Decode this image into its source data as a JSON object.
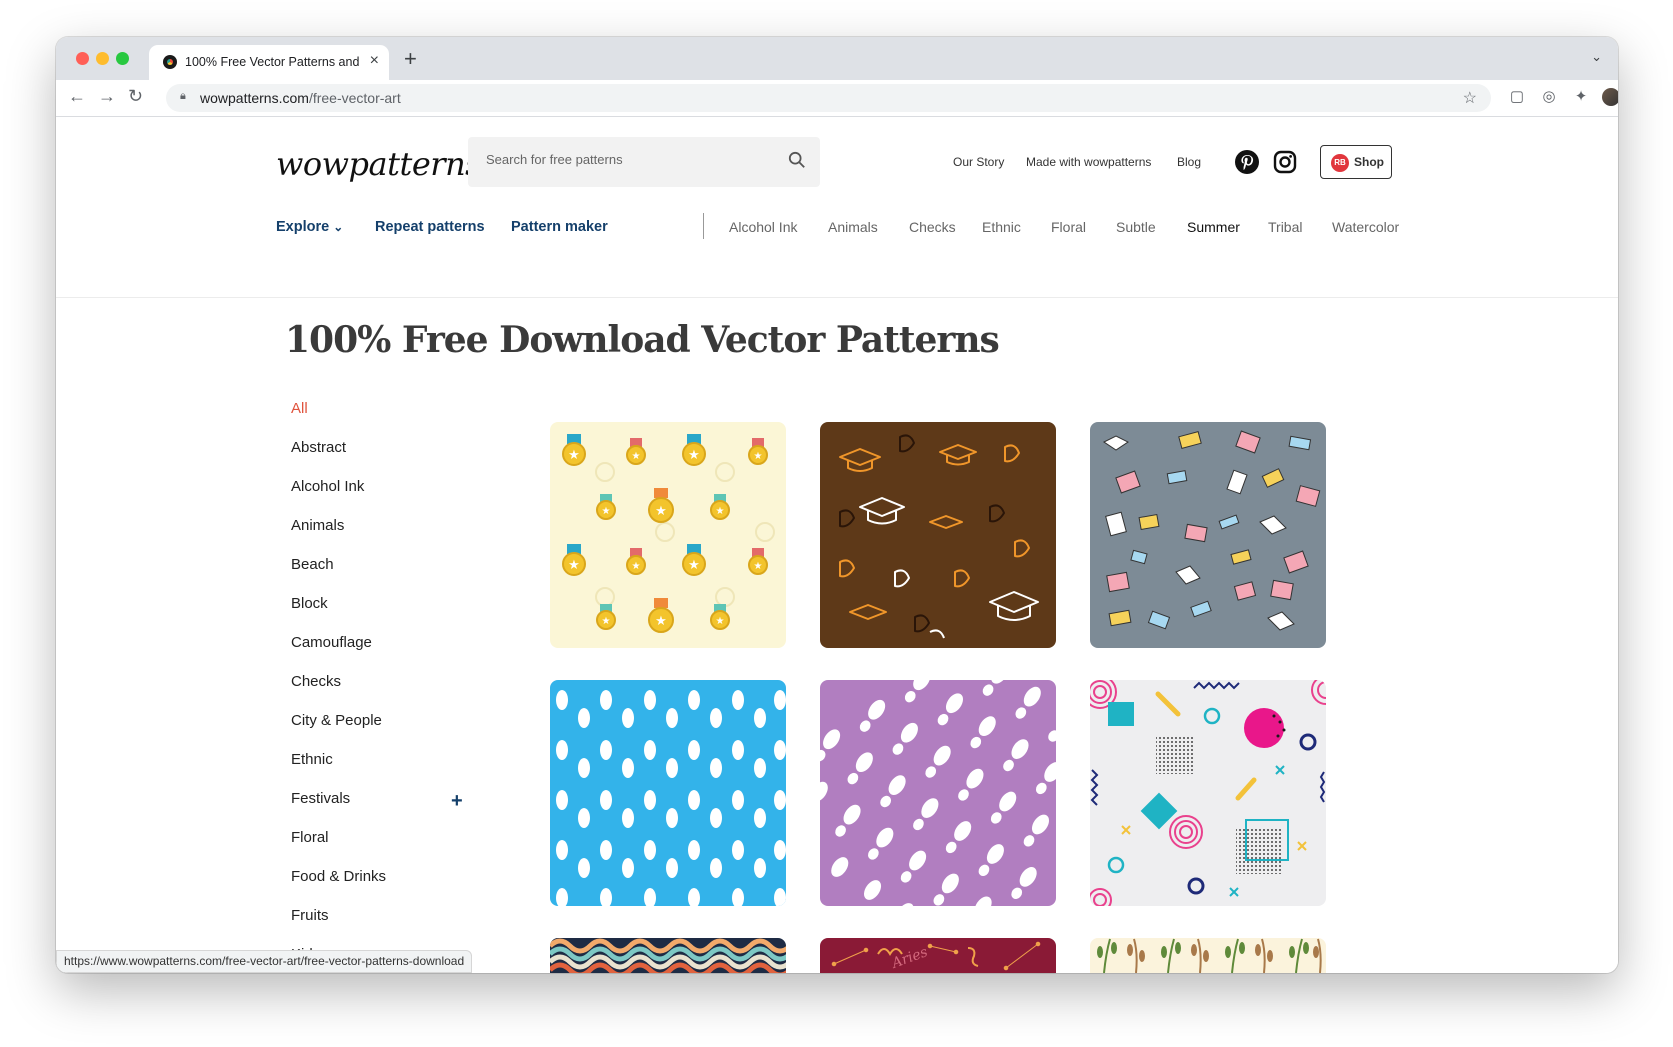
{
  "browser": {
    "tab_title": "100% Free Vector Patterns and",
    "url_host": "wowpatterns.com",
    "url_path": "/free-vector-art",
    "status_url": "https://www.wowpatterns.com/free-vector-art/free-vector-patterns-download"
  },
  "header": {
    "logo": "wowpatterns",
    "search_placeholder": "Search for free patterns",
    "links": [
      "Our Story",
      "Made with wowpatterns",
      "Blog"
    ],
    "shop_label": "Shop",
    "shop_badge": "RB"
  },
  "nav": {
    "primary": [
      "Explore",
      "Repeat patterns",
      "Pattern maker"
    ],
    "categories": [
      "Alcohol Ink",
      "Animals",
      "Checks",
      "Ethnic",
      "Floral",
      "Subtle",
      "Summer",
      "Tribal",
      "Watercolor"
    ],
    "active_category": "Summer"
  },
  "main": {
    "title": "100% Free Download Vector Patterns"
  },
  "sidebar": {
    "items": [
      "All",
      "Abstract",
      "Alcohol Ink",
      "Animals",
      "Beach",
      "Block",
      "Camouflage",
      "Checks",
      "City & People",
      "Ethnic",
      "Festivals",
      "Floral",
      "Food & Drinks",
      "Fruits",
      "Kids"
    ],
    "active": "All"
  },
  "patterns": [
    {
      "name": "medals",
      "bg": "#fbf6d6"
    },
    {
      "name": "graduation-caps",
      "bg": "#5e3918"
    },
    {
      "name": "books",
      "bg": "#7d8b96"
    },
    {
      "name": "footprints",
      "bg": "#33b3ea"
    },
    {
      "name": "shoe-prints",
      "bg": "#b17ec0"
    },
    {
      "name": "memphis-shapes",
      "bg": "#eeeef0"
    },
    {
      "name": "waves",
      "bg": "#1e2b44"
    },
    {
      "name": "zodiac-aries",
      "bg": "#8a1a36",
      "text": "Aries"
    },
    {
      "name": "wheat",
      "bg": "#fbf3dc"
    }
  ],
  "colors": {
    "brand_blue": "#15406b",
    "active_red": "#e0533d"
  }
}
